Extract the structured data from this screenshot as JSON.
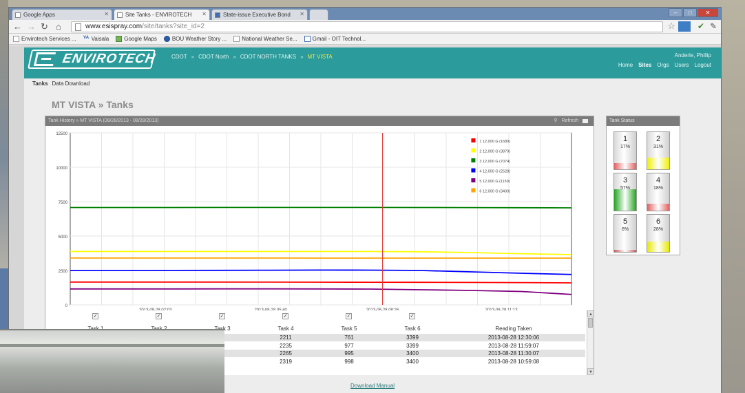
{
  "tabs": [
    {
      "label": "Google Apps"
    },
    {
      "label": "Site Tanks - ENVIROTECH"
    },
    {
      "label": "State-issue Executive Bond"
    }
  ],
  "window_controls": {
    "minimize": "–",
    "maximize": "□",
    "close": "✕"
  },
  "url": {
    "host": "www.esispray.com",
    "path": "/site/tanks?site_id=2"
  },
  "bookmarks": [
    {
      "label": "Envirotech Services ...",
      "icon": "page-icon"
    },
    {
      "label": "Vaisala",
      "icon": "VA"
    },
    {
      "label": "Google Maps",
      "icon": "maps-icon"
    },
    {
      "label": "BOU Weather Story ...",
      "icon": "weather-icon"
    },
    {
      "label": "National Weather Se...",
      "icon": "page-icon"
    },
    {
      "label": "Gmail - OIT Technol...",
      "icon": "mail-icon"
    }
  ],
  "site": {
    "logo": "ENVIROTECH",
    "breadcrumb": [
      "CDOT",
      "CDOT North",
      "CDOT NORTH TANKS",
      "MT VISTA"
    ],
    "breadcrumb_sep": "»",
    "user": "Anderle, Phillip",
    "nav": [
      "Home",
      "Sites",
      "Orgs",
      "Users",
      "Logout"
    ],
    "active_nav": "Sites",
    "subnav": [
      "Tanks",
      "Data Download"
    ],
    "page_title": "MT VISTA » Tanks",
    "download_link": "Download Manual"
  },
  "history": {
    "header": "Tank History » MT VISTA (08/28/2013 - 08/28/2013)",
    "refresh": "Refresh"
  },
  "tank_status": {
    "header": "Tank Status",
    "tanks": [
      {
        "num": "1",
        "pct": "17%",
        "level": 0.17,
        "color": "#e06060"
      },
      {
        "num": "2",
        "pct": "31%",
        "level": 0.31,
        "color": "#f0f000"
      },
      {
        "num": "3",
        "pct": "57%",
        "level": 0.57,
        "color": "#22a522"
      },
      {
        "num": "4",
        "pct": "18%",
        "level": 0.18,
        "color": "#e06060"
      },
      {
        "num": "5",
        "pct": "6%",
        "level": 0.06,
        "color": "#c75b5b"
      },
      {
        "num": "6",
        "pct": "28%",
        "level": 0.28,
        "color": "#e8e800"
      }
    ]
  },
  "table": {
    "columns": [
      "Task 1",
      "Task 2",
      "Task 3",
      "Task 4",
      "Task 5",
      "Task 6",
      "Reading Taken"
    ],
    "check_mark": "✓",
    "rows": [
      [
        "",
        "",
        "",
        "2211",
        "761",
        "3399",
        "2013-08-28 12:30:06"
      ],
      [
        "",
        "",
        "",
        "2235",
        "977",
        "3399",
        "2013-08-28 11:59:07"
      ],
      [
        "",
        "",
        "",
        "2265",
        "995",
        "3400",
        "2013-08-28 11:30:07"
      ],
      [
        "",
        "",
        "",
        "2319",
        "998",
        "3400",
        "2013-08-28 10:59:08"
      ]
    ]
  },
  "chart_data": {
    "type": "line",
    "ylim": [
      0,
      12500
    ],
    "yticks": [
      "12500",
      "10000",
      "7500",
      "5000",
      "2500",
      "0"
    ],
    "xticks": [
      "2013-08-28 02:03",
      "2013-08-28 05:40",
      "2013-08-28 08:26",
      "2013-08-28 11:13"
    ],
    "cursor_label": "2013-08-28 08:26",
    "series": [
      {
        "name": "1 12,000 G (1689)",
        "color": "#ff0000",
        "values": [
          1660,
          1660,
          1660,
          1660,
          1655,
          1650,
          1645,
          1640,
          1630,
          1620,
          1600
        ]
      },
      {
        "name": "2 12,000 G (3879)",
        "color": "#ffff00",
        "values": [
          3879,
          3880,
          3880,
          3882,
          3882,
          3880,
          3878,
          3860,
          3800,
          3720,
          3650
        ]
      },
      {
        "name": "3 12,000 G (7074)",
        "color": "#008000",
        "values": [
          7074,
          7074,
          7076,
          7078,
          7080,
          7080,
          7078,
          7075,
          7070,
          7060,
          7050
        ]
      },
      {
        "name": "4 12,000 G (2528)",
        "color": "#0000ff",
        "values": [
          2500,
          2500,
          2505,
          2510,
          2520,
          2528,
          2525,
          2500,
          2400,
          2300,
          2211
        ]
      },
      {
        "name": "5 12,000 G (1159)",
        "color": "#800080",
        "values": [
          1159,
          1160,
          1162,
          1165,
          1165,
          1160,
          1150,
          1100,
          1050,
          977,
          761
        ]
      },
      {
        "name": "6 12,000 G (3400)",
        "color": "#ffa500",
        "values": [
          3405,
          3405,
          3405,
          3404,
          3404,
          3402,
          3402,
          3401,
          3400,
          3400,
          3399
        ]
      }
    ]
  }
}
